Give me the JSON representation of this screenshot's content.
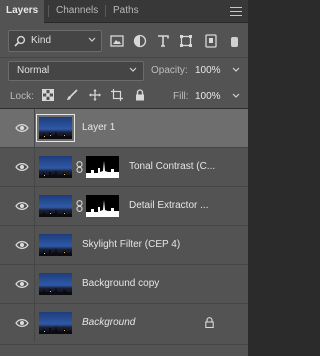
{
  "tabs": [
    {
      "label": "Layers",
      "active": true
    },
    {
      "label": "Channels",
      "active": false
    },
    {
      "label": "Paths",
      "active": false
    }
  ],
  "filter": {
    "kind_label": "Kind"
  },
  "blend": {
    "mode": "Normal",
    "opacity_label": "Opacity:",
    "opacity_value": "100%"
  },
  "lock": {
    "label": "Lock:",
    "fill_label": "Fill:",
    "fill_value": "100%"
  },
  "layers": [
    {
      "name": "Layer 1",
      "selected": true,
      "has_mask": false,
      "italic": false,
      "locked": false
    },
    {
      "name": "Tonal Contrast (C...",
      "selected": false,
      "has_mask": true,
      "italic": false,
      "locked": false
    },
    {
      "name": "Detail Extractor ...",
      "selected": false,
      "has_mask": true,
      "italic": false,
      "locked": false
    },
    {
      "name": "Skylight Filter (CEP 4)",
      "selected": false,
      "has_mask": false,
      "italic": false,
      "locked": false
    },
    {
      "name": "Background copy",
      "selected": false,
      "has_mask": false,
      "italic": false,
      "locked": false
    },
    {
      "name": "Background",
      "selected": false,
      "has_mask": false,
      "italic": true,
      "locked": true
    }
  ],
  "colors": {
    "panel_bg": "#535353",
    "selected_row": "#6e6e6e",
    "tab_bar": "#383838"
  }
}
